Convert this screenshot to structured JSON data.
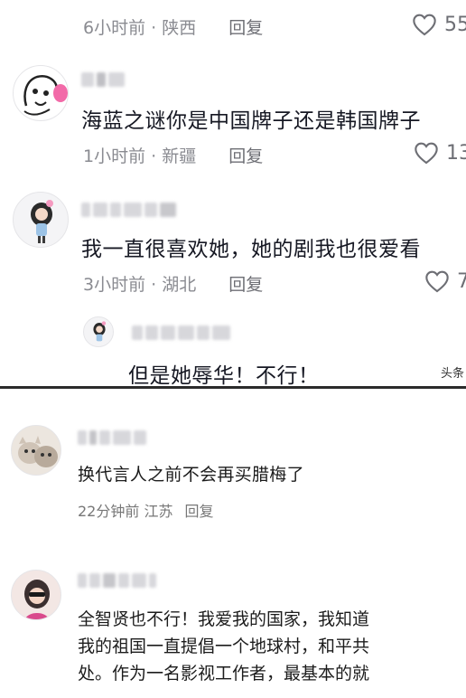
{
  "panel1": {
    "comments": [
      {
        "time": "6小时前",
        "region": "陕西",
        "reply_label": "回复",
        "likes": "55"
      },
      {
        "text": "海蓝之谜你是中国牌子还是韩国牌子",
        "time": "1小时前",
        "region": "新疆",
        "reply_label": "回复",
        "likes": "13"
      },
      {
        "text": "我一直很喜欢她，她的剧我也很爱看",
        "time": "3小时前",
        "region": "湖北",
        "reply_label": "回复",
        "likes": "7"
      }
    ],
    "sub_reply": {
      "text": "但是她辱华！不行！"
    },
    "separator": "·",
    "watermark": "头条"
  },
  "panel2": {
    "comments": [
      {
        "text": "换代言人之前不会再买腊梅了",
        "meta": "22分钟前 江苏",
        "reply_label": "回复"
      },
      {
        "lines": [
          "全智贤也不行！我爱我的国家，我知道",
          "我的祖国一直提倡一个地球村，和平共",
          "处。作为一名影视工作者，最基本的就"
        ]
      }
    ]
  },
  "colors": {
    "text": "#161823",
    "meta": "#8a8b91",
    "divider": "#2b2b2b"
  }
}
